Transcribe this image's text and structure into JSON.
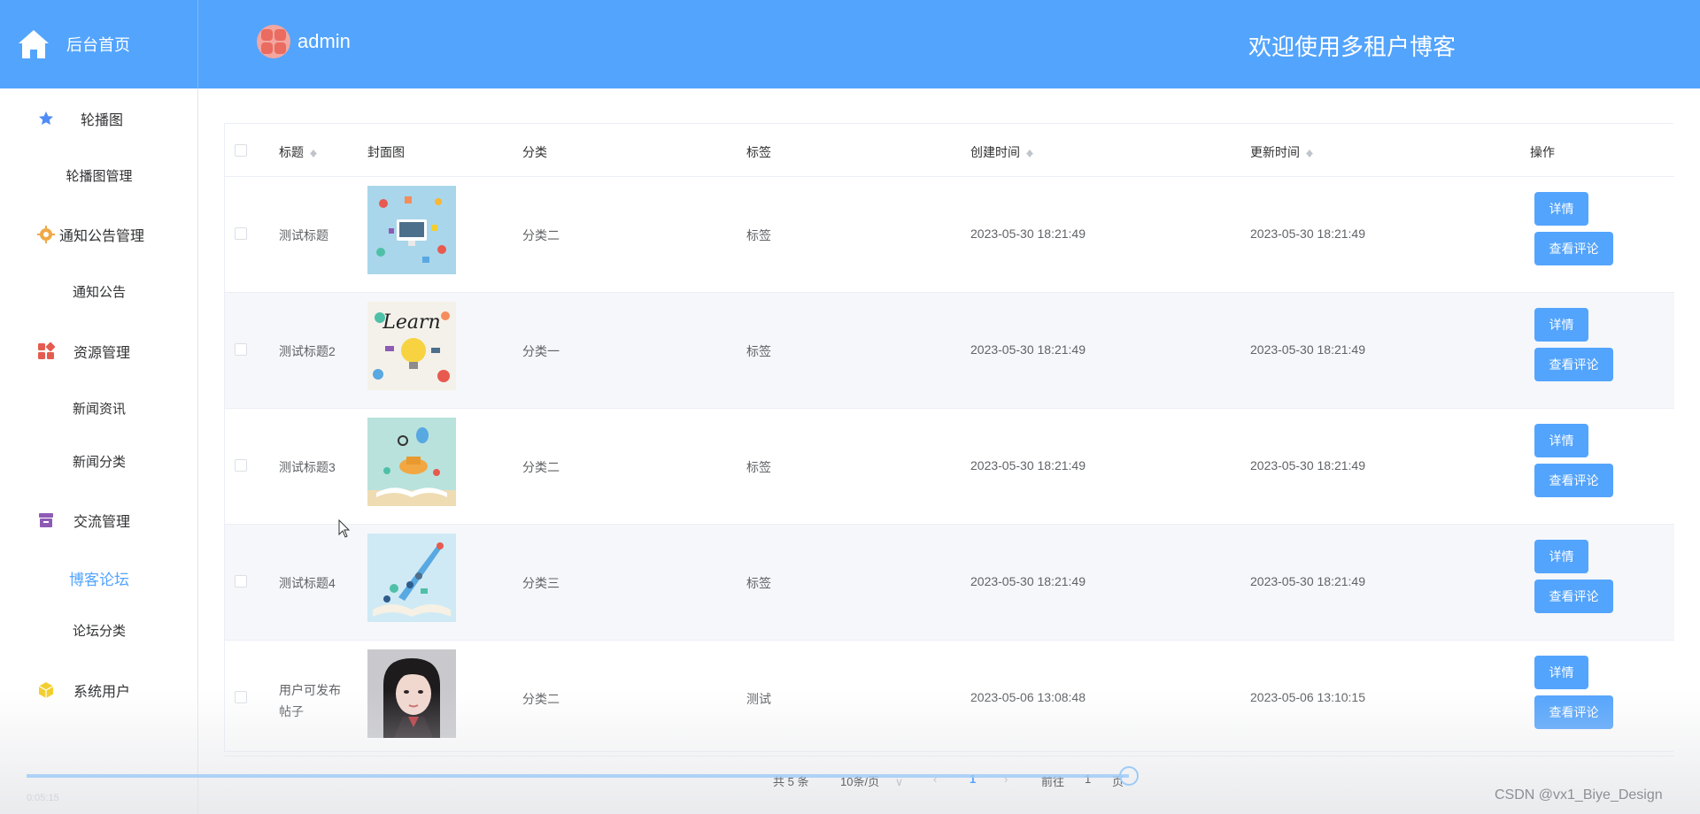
{
  "colors": {
    "accent": "#53a4fd",
    "header_bg": "#53a4fd",
    "stripe": "#f6f7fa"
  },
  "header": {
    "home_label": "后台首页",
    "user_name": "admin",
    "welcome": "欢迎使用多租户博客"
  },
  "sidebar": {
    "groups": [
      {
        "label": "轮播图",
        "icon": "star-icon",
        "items": [
          "轮播图管理"
        ]
      },
      {
        "label": "通知公告管理",
        "icon": "gear-icon",
        "items": [
          "通知公告"
        ]
      },
      {
        "label": "资源管理",
        "icon": "grid-icon",
        "items": [
          "新闻资讯",
          "新闻分类"
        ]
      },
      {
        "label": "交流管理",
        "icon": "archive-icon",
        "items": [
          "博客论坛",
          "论坛分类"
        ]
      },
      {
        "label": "系统用户",
        "icon": "cube-icon",
        "items": []
      }
    ],
    "active_item": "博客论坛"
  },
  "table": {
    "columns": [
      "标题",
      "封面图",
      "分类",
      "标签",
      "创建时间",
      "更新时间",
      "操作"
    ],
    "detail_label": "详情",
    "comment_label": "查看评论",
    "rows": [
      {
        "title": "测试标题",
        "cover": "tech-illustration",
        "category": "分类二",
        "tag": "标签",
        "created": "2023-05-30 18:21:49",
        "updated": "2023-05-30 18:21:49"
      },
      {
        "title": "测试标题2",
        "cover": "learn-illustration",
        "category": "分类一",
        "tag": "标签",
        "created": "2023-05-30 18:21:49",
        "updated": "2023-05-30 18:21:49"
      },
      {
        "title": "测试标题3",
        "cover": "book-balloon-illustration",
        "category": "分类二",
        "tag": "标签",
        "created": "2023-05-30 18:21:49",
        "updated": "2023-05-30 18:21:49"
      },
      {
        "title": "测试标题4",
        "cover": "book-rocket-illustration",
        "category": "分类三",
        "tag": "标签",
        "created": "2023-05-30 18:21:49",
        "updated": "2023-05-30 18:21:49"
      },
      {
        "title_line1": "用户可发布",
        "title_line2": "帖子",
        "cover": "portrait-photo",
        "category": "分类二",
        "tag": "测试",
        "created": "2023-05-06 13:08:48",
        "updated": "2023-05-06 13:10:15"
      }
    ]
  },
  "pagination": {
    "total": "共 5 条",
    "page_size": "10条/页",
    "current_page": "1",
    "goto_label": "前往",
    "goto_value": "1",
    "page_unit": "页"
  },
  "video": {
    "time": "0:05:15"
  },
  "watermark": "CSDN @vx1_Biye_Design"
}
